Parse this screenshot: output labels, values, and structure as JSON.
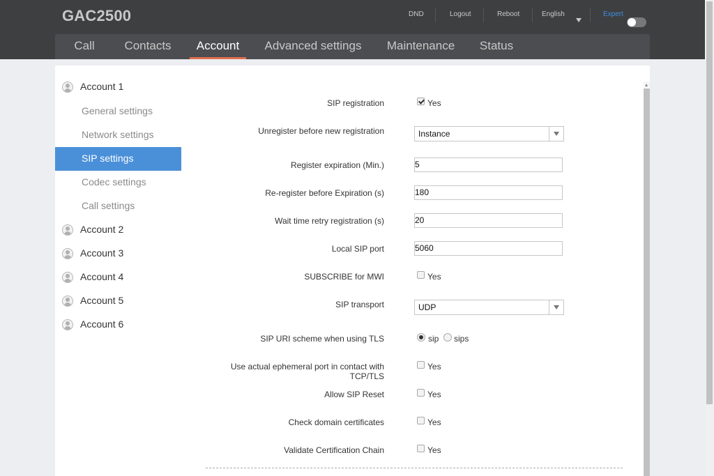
{
  "header": {
    "brand": "GAC2500",
    "links": {
      "dnd": "DND",
      "logout": "Logout",
      "reboot": "Reboot",
      "language": "English",
      "expert": "Expert"
    },
    "expert_enabled": false
  },
  "nav": {
    "tabs": [
      {
        "label": "Call"
      },
      {
        "label": "Contacts"
      },
      {
        "label": "Account"
      },
      {
        "label": "Advanced settings"
      },
      {
        "label": "Maintenance"
      },
      {
        "label": "Status"
      }
    ],
    "active": "Account"
  },
  "sidebar": {
    "accounts": [
      {
        "label": "Account 1"
      },
      {
        "label": "Account 2"
      },
      {
        "label": "Account 3"
      },
      {
        "label": "Account 4"
      },
      {
        "label": "Account 5"
      },
      {
        "label": "Account 6"
      }
    ],
    "subitems": [
      {
        "label": "General settings"
      },
      {
        "label": "Network settings"
      },
      {
        "label": "SIP settings"
      },
      {
        "label": "Codec settings"
      },
      {
        "label": "Call settings"
      }
    ],
    "active_subitem": "SIP settings"
  },
  "form": {
    "yes_text": "Yes",
    "sip_registration": {
      "label": "SIP registration",
      "checked": true
    },
    "unregister_before_new": {
      "label": "Unregister before new registration",
      "value": "Instance"
    },
    "register_expiration": {
      "label": "Register expiration (Min.)",
      "value": "5"
    },
    "reregister_before_expiration": {
      "label": "Re-register before Expiration (s)",
      "value": "180"
    },
    "wait_time_retry": {
      "label": "Wait time retry registration (s)",
      "value": "20"
    },
    "local_sip_port": {
      "label": "Local SIP port",
      "value": "5060"
    },
    "subscribe_mwi": {
      "label": "SUBSCRIBE for MWI",
      "checked": false
    },
    "sip_transport": {
      "label": "SIP transport",
      "value": "UDP"
    },
    "sip_uri_scheme": {
      "label": "SIP URI scheme when using TLS",
      "options": [
        "sip",
        "sips"
      ],
      "selected": "sip"
    },
    "ephemeral_port": {
      "label_line1": "Use actual ephemeral port in contact with",
      "label_line2": "TCP/TLS",
      "checked": false
    },
    "allow_sip_reset": {
      "label": "Allow SIP Reset",
      "checked": false
    },
    "check_domain_certs": {
      "label": "Check domain certificates",
      "checked": false
    },
    "validate_cert_chain": {
      "label": "Validate Certification Chain",
      "checked": false
    }
  },
  "colors": {
    "header_bg": "#3e3f41",
    "nav_bg": "#4c4d50",
    "active_tab_underline": "#e07050",
    "active_sidebar_bg": "#4a90d9",
    "expert_label": "#3d8fe0"
  }
}
